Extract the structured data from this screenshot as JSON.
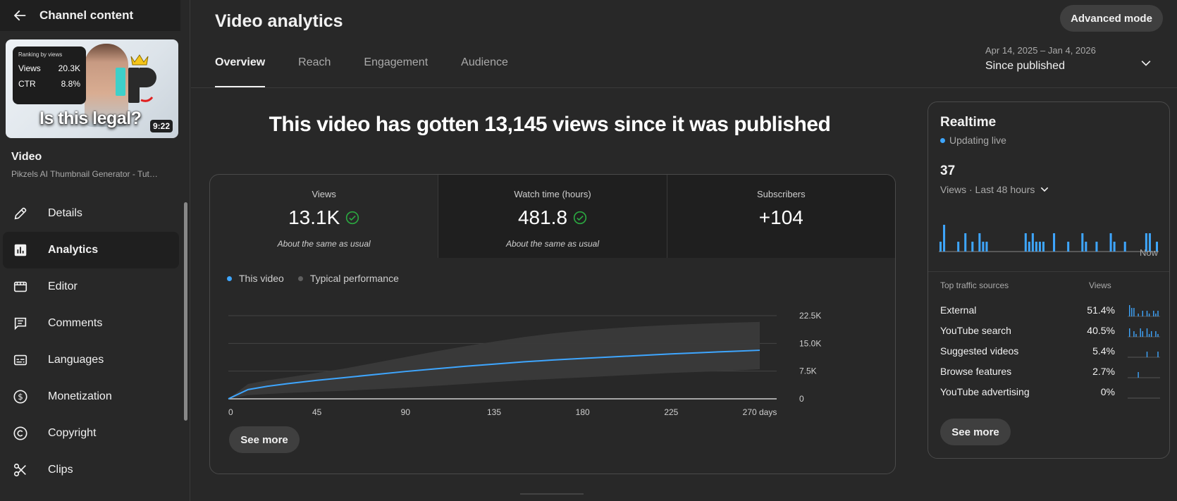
{
  "sidebar": {
    "header_title": "Channel content",
    "thumbnail": {
      "card_title": "Ranking by views",
      "views_label": "Views",
      "views_value": "20.3K",
      "ctr_label": "CTR",
      "ctr_value": "8.8%",
      "caption": "Is this legal?",
      "duration": "9:22"
    },
    "video_label": "Video",
    "video_title": "Pikzels AI Thumbnail Generator - Tut…",
    "items": [
      {
        "label": "Details",
        "icon": "pencil-icon"
      },
      {
        "label": "Analytics",
        "icon": "analytics-icon"
      },
      {
        "label": "Editor",
        "icon": "editor-icon"
      },
      {
        "label": "Comments",
        "icon": "comments-icon"
      },
      {
        "label": "Languages",
        "icon": "subtitles-icon"
      },
      {
        "label": "Monetization",
        "icon": "dollar-icon"
      },
      {
        "label": "Copyright",
        "icon": "copyright-icon"
      },
      {
        "label": "Clips",
        "icon": "scissors-icon"
      }
    ]
  },
  "header": {
    "title": "Video analytics",
    "advanced_mode": "Advanced mode",
    "tabs": [
      "Overview",
      "Reach",
      "Engagement",
      "Audience"
    ],
    "active_tab": "Overview",
    "date_range": "Apr 14, 2025 – Jan 4, 2026",
    "date_label": "Since published"
  },
  "headline": "This video has gotten 13,145 views since it was published",
  "metrics": [
    {
      "label": "Views",
      "value": "13.1K",
      "note": "About the same as usual",
      "check": true
    },
    {
      "label": "Watch time (hours)",
      "value": "481.8",
      "note": "About the same as usual",
      "check": true
    },
    {
      "label": "Subscribers",
      "value": "+104",
      "note": "",
      "check": false
    }
  ],
  "legend": {
    "this_video": "This video",
    "typical": "Typical performance"
  },
  "see_more": "See more",
  "colors": {
    "accent": "#3ea6ff",
    "check": "#2ba640",
    "band": "#3a3a3a"
  },
  "chart_data": {
    "type": "line",
    "x": [
      0,
      10,
      20,
      30,
      45,
      60,
      75,
      90,
      105,
      120,
      135,
      150,
      165,
      180,
      195,
      210,
      225,
      240,
      255,
      270
    ],
    "series": [
      {
        "name": "This video",
        "values": [
          0,
          2500,
          3400,
          4100,
          5000,
          5800,
          6600,
          7400,
          8100,
          8800,
          9400,
          10000,
          10500,
          10950,
          11350,
          11750,
          12150,
          12500,
          12830,
          13145
        ]
      },
      {
        "name": "Typical performance",
        "lower": [
          0,
          1000,
          1300,
          1600,
          1900,
          2200,
          2600,
          3000,
          3500,
          4000,
          4500,
          5000,
          5400,
          5800,
          6200,
          6600,
          7000,
          7300,
          7600,
          8000
        ],
        "upper": [
          0,
          4000,
          5000,
          5800,
          7000,
          8300,
          9800,
          11300,
          12800,
          14200,
          15500,
          16700,
          17700,
          18500,
          19100,
          19600,
          20000,
          20300,
          20600,
          20800
        ]
      }
    ],
    "x_ticks": [
      0,
      45,
      90,
      135,
      180,
      225,
      270
    ],
    "x_tick_labels": [
      "0",
      "45",
      "90",
      "135",
      "180",
      "225",
      "270 days"
    ],
    "y_ticks": [
      0,
      7500,
      15000,
      22500
    ],
    "y_tick_labels": [
      "0",
      "7.5K",
      "15.0K",
      "22.5K"
    ],
    "xlim": [
      0,
      270
    ],
    "ylim": [
      0,
      22500
    ],
    "grid": true,
    "legend_position": "top-left"
  },
  "realtime": {
    "title": "Realtime",
    "live_label": "Updating live",
    "count": "37",
    "period": "Views · Last 48 hours",
    "now_label": "Now",
    "hourly_views": [
      1,
      3,
      0,
      0,
      0,
      1,
      0,
      2,
      0,
      1,
      0,
      2,
      1,
      1,
      0,
      0,
      0,
      0,
      0,
      0,
      0,
      0,
      0,
      0,
      2,
      1,
      2,
      1,
      1,
      1,
      0,
      0,
      2,
      0,
      0,
      0,
      1,
      0,
      0,
      0,
      2,
      1,
      0,
      0,
      1,
      0,
      0,
      0,
      2,
      1,
      0,
      0,
      1,
      0,
      0,
      0,
      0,
      0,
      2,
      2,
      0,
      1
    ]
  },
  "traffic_sources": {
    "header_label": "Top traffic sources",
    "header_value": "Views",
    "rows": [
      {
        "name": "External",
        "pct": "51.4%",
        "spark": [
          4,
          3,
          3,
          0,
          1,
          0,
          2,
          0,
          2,
          1,
          0,
          2,
          1,
          2
        ]
      },
      {
        "name": "YouTube search",
        "pct": "40.5%",
        "spark": [
          3,
          0,
          2,
          1,
          0,
          3,
          2,
          0,
          3,
          1,
          2,
          0,
          2,
          1
        ]
      },
      {
        "name": "Suggested videos",
        "pct": "5.4%",
        "spark": [
          0,
          0,
          0,
          0,
          0,
          0,
          0,
          0,
          2,
          0,
          0,
          0,
          0,
          2
        ]
      },
      {
        "name": "Browse features",
        "pct": "2.7%",
        "spark": [
          0,
          0,
          0,
          0,
          2,
          0,
          0,
          0,
          0,
          0,
          0,
          0,
          0,
          0
        ]
      },
      {
        "name": "YouTube advertising",
        "pct": "0%",
        "spark": [
          0,
          0,
          0,
          0,
          0,
          0,
          0,
          0,
          0,
          0,
          0,
          0,
          0,
          0
        ]
      }
    ]
  }
}
